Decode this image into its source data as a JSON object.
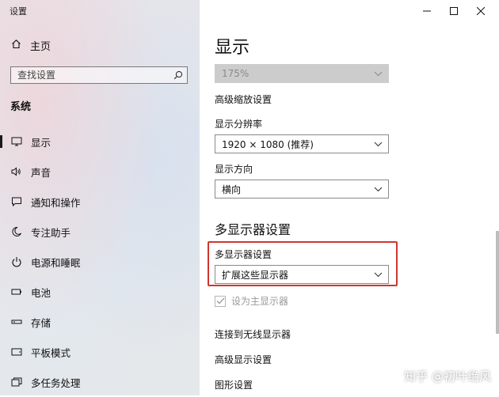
{
  "window": {
    "title": "设置"
  },
  "sidebar": {
    "home_label": "主页",
    "search_placeholder": "查找设置",
    "section_heading": "系统",
    "items": [
      {
        "label": "显示",
        "icon": "monitor-icon",
        "active": true
      },
      {
        "label": "声音",
        "icon": "speaker-icon"
      },
      {
        "label": "通知和操作",
        "icon": "message-icon"
      },
      {
        "label": "专注助手",
        "icon": "moon-icon"
      },
      {
        "label": "电源和睡眠",
        "icon": "power-icon"
      },
      {
        "label": "电池",
        "icon": "battery-icon"
      },
      {
        "label": "存储",
        "icon": "storage-icon"
      },
      {
        "label": "平板模式",
        "icon": "tablet-icon"
      },
      {
        "label": "多任务处理",
        "icon": "multitask-icon"
      }
    ]
  },
  "main": {
    "title": "显示",
    "scale": {
      "value": "175%",
      "disabled": true
    },
    "advanced_scaling_link": "高级缩放设置",
    "resolution": {
      "label": "显示分辨率",
      "value": "1920 × 1080 (推荐)"
    },
    "orientation": {
      "label": "显示方向",
      "value": "横向"
    },
    "multi_display": {
      "heading": "多显示器设置",
      "label": "多显示器设置",
      "value": "扩展这些显示器"
    },
    "primary_checkbox": {
      "label": "设为主显示器",
      "checked": true,
      "disabled": true
    },
    "links": {
      "wireless": "连接到无线显示器",
      "advanced_display": "高级显示设置",
      "graphics": "图形设置"
    }
  },
  "watermark": "知乎 @初叶绝风",
  "colors": {
    "highlight_border": "#d0352f",
    "disabled_select_bg": "#cccccc"
  }
}
